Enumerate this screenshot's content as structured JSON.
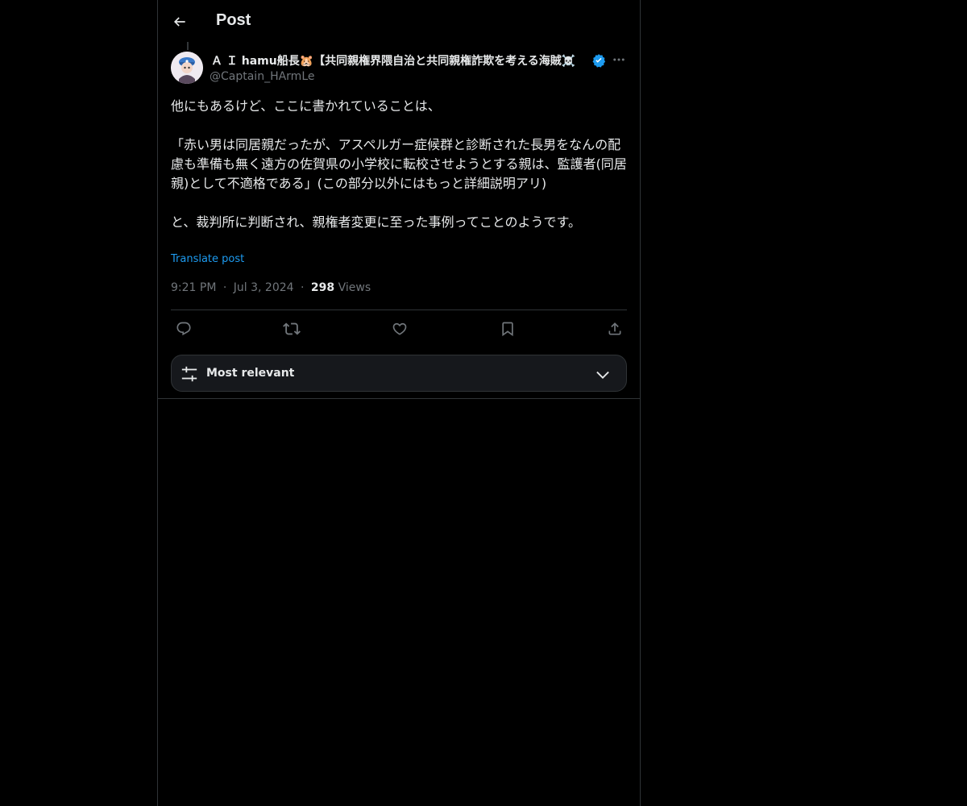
{
  "header": {
    "title": "Post",
    "back_icon": "arrow-left-icon"
  },
  "post": {
    "author": {
      "display_name": "Ａ Ｉ hamu船長🐹【共同親権界隈自治と共同親権詐欺を考える海賊☠️",
      "handle": "@Captain_HArmLe",
      "verified": true,
      "verified_color": "#1d9bf0"
    },
    "body": {
      "line1": "他にもあるけど、ここに書かれていることは、",
      "line2": "「赤い男は同居親だったが、アスペルガー症候群と診断された長男をなんの配慮も準備も無く遠方の佐賀県の小学校に転校させようとする親は、監護者(同居親)として不適格である」(この部分以外にはもっと詳細説明アリ)",
      "line3": "と、裁判所に判断され、親権者変更に至った事例ってことのようです。"
    },
    "translate_label": "Translate post",
    "time": "9:21 PM",
    "separator": "·",
    "date": "Jul 3, 2024",
    "views_count": "298",
    "views_label": "Views"
  },
  "actions": [
    {
      "name": "reply",
      "icon": "reply-icon"
    },
    {
      "name": "repost",
      "icon": "repost-icon"
    },
    {
      "name": "like",
      "icon": "heart-icon"
    },
    {
      "name": "bookmark",
      "icon": "bookmark-icon"
    },
    {
      "name": "share",
      "icon": "share-icon"
    }
  ],
  "sort": {
    "label": "Most relevant",
    "icon": "sliders-icon",
    "chevron": "chevron-down-icon"
  },
  "colors": {
    "background": "#000000",
    "text_primary": "#e7e9ea",
    "text_secondary": "#71767b",
    "accent": "#1d9bf0",
    "border": "#2f3336"
  }
}
